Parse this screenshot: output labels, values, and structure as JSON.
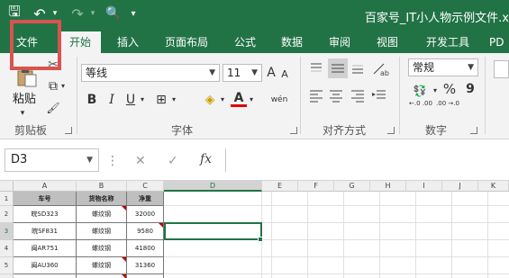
{
  "title_bar": {
    "title": "百家号_IT小人物示例文件.x",
    "save_glyph": "🖫",
    "undo_glyph": "↶",
    "redo_glyph": "↷",
    "preview_glyph": "🔍",
    "customize_glyph": "▾"
  },
  "tabs": [
    "文件",
    "开始",
    "插入",
    "页面布局",
    "公式",
    "数据",
    "审阅",
    "视图",
    "开发工具",
    "PD"
  ],
  "active_tab": "开始",
  "ribbon": {
    "clipboard": {
      "label": "剪贴板",
      "paste_label": "粘贴",
      "cut_glyph": "✂",
      "copy_glyph": "⧉",
      "painter_glyph": "🖌"
    },
    "font": {
      "label": "字体",
      "font_name": "等线",
      "font_size": "11",
      "grow": "A",
      "shrink": "A",
      "bold": "B",
      "italic": "I",
      "underline": "U",
      "wen": "wén",
      "font_color_glyph": "A",
      "fill_glyph": "◈",
      "border_glyph": "⊞"
    },
    "alignment": {
      "label": "对齐方式"
    },
    "number": {
      "label": "数字",
      "format": "常规",
      "percent": "%",
      "comma": "9",
      "inc_decimal": "←.0 .00",
      "dec_decimal": ".00 →.0"
    }
  },
  "formula_bar": {
    "name_box": "D3",
    "cancel_glyph": "✕",
    "enter_glyph": "✓",
    "fx_label": "fx",
    "value": ""
  },
  "sheet": {
    "columns": [
      "A",
      "B",
      "C",
      "D",
      "E",
      "F",
      "G",
      "H",
      "I",
      "J",
      "K"
    ],
    "selected_column": "D",
    "rows": [
      "1",
      "2",
      "3",
      "4",
      "5"
    ],
    "selected_row": "3",
    "headers": [
      "车号",
      "货物名称",
      "净重"
    ],
    "data": [
      [
        "皖SD323",
        "螺纹钢",
        "32000"
      ],
      [
        "皖SF831",
        "螺纹钢",
        "9580"
      ],
      [
        "闽AR751",
        "螺纹钢",
        "41800"
      ],
      [
        "闽AU360",
        "螺纹钢",
        "31360"
      ]
    ]
  },
  "colors": {
    "brand": "#217346",
    "highlight": "#d9534f",
    "header_fill": "#bfbfbf",
    "comment_marker": "#c00000"
  }
}
